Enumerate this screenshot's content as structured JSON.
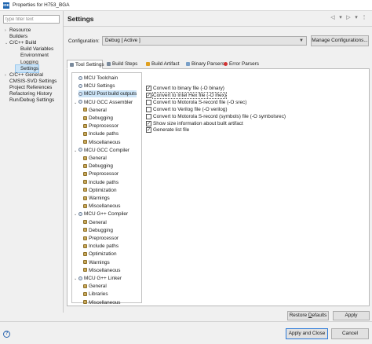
{
  "window": {
    "title": "Properties for H753_BGA",
    "app_icon": "IDE"
  },
  "filter": {
    "placeholder": "type filter text"
  },
  "nav": [
    {
      "label": "Resource",
      "twisty": "›"
    },
    {
      "label": "Builders",
      "twisty": ""
    },
    {
      "label": "C/C++ Build",
      "twisty": "⌄"
    },
    {
      "label": "Build Variables",
      "twisty": ""
    },
    {
      "label": "Environment",
      "twisty": ""
    },
    {
      "label": "Logging",
      "twisty": ""
    },
    {
      "label": "Settings",
      "twisty": "",
      "selected": true
    },
    {
      "label": "C/C++ General",
      "twisty": "›"
    },
    {
      "label": "CMSIS-SVD Settings",
      "twisty": ""
    },
    {
      "label": "Project References",
      "twisty": ""
    },
    {
      "label": "Refactoring History",
      "twisty": ""
    },
    {
      "label": "Run/Debug Settings",
      "twisty": ""
    }
  ],
  "header": {
    "title": "Settings",
    "icons": [
      "◁",
      "▾",
      "▷",
      "▾",
      "⋮"
    ]
  },
  "config": {
    "label": "Configuration:",
    "value": "Debug  [ Active ]",
    "manage_label": "Manage Configurations..."
  },
  "tabs": [
    {
      "label": "Tool Settings",
      "active": true,
      "icon_color": "#7a8a9c"
    },
    {
      "label": "Build Steps",
      "icon_color": "#7a8a9c"
    },
    {
      "label": "Build Artifact",
      "icon_color": "#e0a020"
    },
    {
      "label": "Binary Parsers",
      "icon_color": "#7aa0c8"
    },
    {
      "label": "Error Parsers",
      "icon_color": "#d33333"
    }
  ],
  "tool_tree": [
    {
      "label": "MCU Toolchain",
      "level": 1,
      "icon": "gear",
      "twisty": ""
    },
    {
      "label": "MCU Settings",
      "level": 1,
      "icon": "gear",
      "twisty": ""
    },
    {
      "label": "MCU Post build outputs",
      "level": 1,
      "icon": "gear",
      "twisty": "",
      "selected": true
    },
    {
      "label": "MCU GCC Assembler",
      "level": 0,
      "icon": "gear",
      "twisty": "⌄"
    },
    {
      "label": "General",
      "level": 2,
      "icon": "leaf",
      "twisty": ""
    },
    {
      "label": "Debugging",
      "level": 2,
      "icon": "leaf",
      "twisty": ""
    },
    {
      "label": "Preprocessor",
      "level": 2,
      "icon": "leaf",
      "twisty": ""
    },
    {
      "label": "Include paths",
      "level": 2,
      "icon": "leaf",
      "twisty": ""
    },
    {
      "label": "Miscellaneous",
      "level": 2,
      "icon": "leaf",
      "twisty": ""
    },
    {
      "label": "MCU GCC Compiler",
      "level": 0,
      "icon": "gear",
      "twisty": "⌄"
    },
    {
      "label": "General",
      "level": 2,
      "icon": "leaf",
      "twisty": ""
    },
    {
      "label": "Debugging",
      "level": 2,
      "icon": "leaf",
      "twisty": ""
    },
    {
      "label": "Preprocessor",
      "level": 2,
      "icon": "leaf",
      "twisty": ""
    },
    {
      "label": "Include paths",
      "level": 2,
      "icon": "leaf",
      "twisty": ""
    },
    {
      "label": "Optimization",
      "level": 2,
      "icon": "leaf",
      "twisty": ""
    },
    {
      "label": "Warnings",
      "level": 2,
      "icon": "leaf",
      "twisty": ""
    },
    {
      "label": "Miscellaneous",
      "level": 2,
      "icon": "leaf",
      "twisty": ""
    },
    {
      "label": "MCU G++ Compiler",
      "level": 0,
      "icon": "gear",
      "twisty": "⌄"
    },
    {
      "label": "General",
      "level": 2,
      "icon": "leaf",
      "twisty": ""
    },
    {
      "label": "Debugging",
      "level": 2,
      "icon": "leaf",
      "twisty": ""
    },
    {
      "label": "Preprocessor",
      "level": 2,
      "icon": "leaf",
      "twisty": ""
    },
    {
      "label": "Include paths",
      "level": 2,
      "icon": "leaf",
      "twisty": ""
    },
    {
      "label": "Optimization",
      "level": 2,
      "icon": "leaf",
      "twisty": ""
    },
    {
      "label": "Warnings",
      "level": 2,
      "icon": "leaf",
      "twisty": ""
    },
    {
      "label": "Miscellaneous",
      "level": 2,
      "icon": "leaf",
      "twisty": ""
    },
    {
      "label": "MCU G++ Linker",
      "level": 0,
      "icon": "gear",
      "twisty": "⌄"
    },
    {
      "label": "General",
      "level": 2,
      "icon": "leaf",
      "twisty": ""
    },
    {
      "label": "Libraries",
      "level": 2,
      "icon": "leaf",
      "twisty": ""
    },
    {
      "label": "Miscellaneous",
      "level": 2,
      "icon": "leaf",
      "twisty": ""
    }
  ],
  "options": [
    {
      "label": "Convert to binary file (-O binary)",
      "checked": true
    },
    {
      "label": "Convert to Intel Hex file (-O ihex)",
      "checked": true,
      "highlighted": true
    },
    {
      "label": "Convert to Motorola S-record file (-O srec)",
      "checked": false
    },
    {
      "label": "Convert to Verilog file (-O verilog)",
      "checked": false
    },
    {
      "label": "Convert to Motorola S-record (symbols) file (-O symbolsrec)",
      "checked": false
    },
    {
      "label": "Show size information about built artifact",
      "checked": true
    },
    {
      "label": "Generate list file",
      "checked": true
    }
  ],
  "buttons": {
    "restore_pre": "Restore ",
    "restore_u": "D",
    "restore_post": "efaults",
    "apply": "Apply",
    "apply_close": "Apply and Close",
    "cancel": "Cancel"
  },
  "colors": {
    "selection": "#cce4f7",
    "default_button_border": "#2b79d8"
  }
}
